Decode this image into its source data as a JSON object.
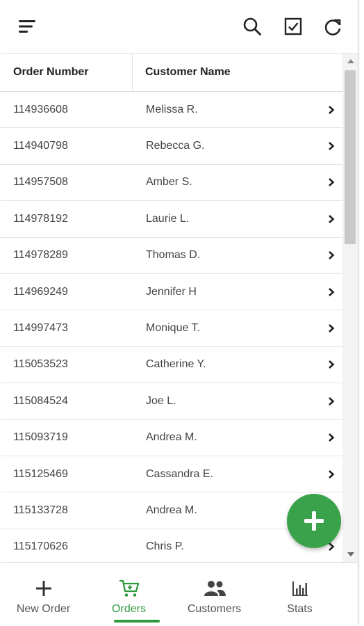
{
  "toolbar": {
    "icons": [
      "menu-icon",
      "search-icon",
      "checkbox-icon",
      "refresh-icon"
    ]
  },
  "table": {
    "headers": [
      "Order Number",
      "Customer Name"
    ],
    "rows": [
      {
        "order": "114936608",
        "customer": "Melissa R."
      },
      {
        "order": "114940798",
        "customer": "Rebecca G."
      },
      {
        "order": "114957508",
        "customer": "Amber S."
      },
      {
        "order": "114978192",
        "customer": "Laurie L."
      },
      {
        "order": "114978289",
        "customer": "Thomas D."
      },
      {
        "order": "114969249",
        "customer": "Jennifer H"
      },
      {
        "order": "114997473",
        "customer": "Monique T."
      },
      {
        "order": "115053523",
        "customer": "Catherine Y."
      },
      {
        "order": "115084524",
        "customer": "Joe L."
      },
      {
        "order": "115093719",
        "customer": "Andrea M."
      },
      {
        "order": "115125469",
        "customer": "Cassandra E."
      },
      {
        "order": "115133728",
        "customer": "Andrea M."
      },
      {
        "order": "115170626",
        "customer": "Chris P."
      }
    ]
  },
  "fab": {
    "icon": "plus-icon"
  },
  "bottom_nav": {
    "items": [
      {
        "label": "New Order",
        "icon": "plus-icon"
      },
      {
        "label": "Orders",
        "icon": "cart-icon"
      },
      {
        "label": "Customers",
        "icon": "people-icon"
      },
      {
        "label": "Stats",
        "icon": "bar-chart-icon"
      }
    ],
    "active": "Orders"
  },
  "colors": {
    "accent": "#3aa24a",
    "active_nav": "#2e9a3e",
    "text": "#444444"
  }
}
